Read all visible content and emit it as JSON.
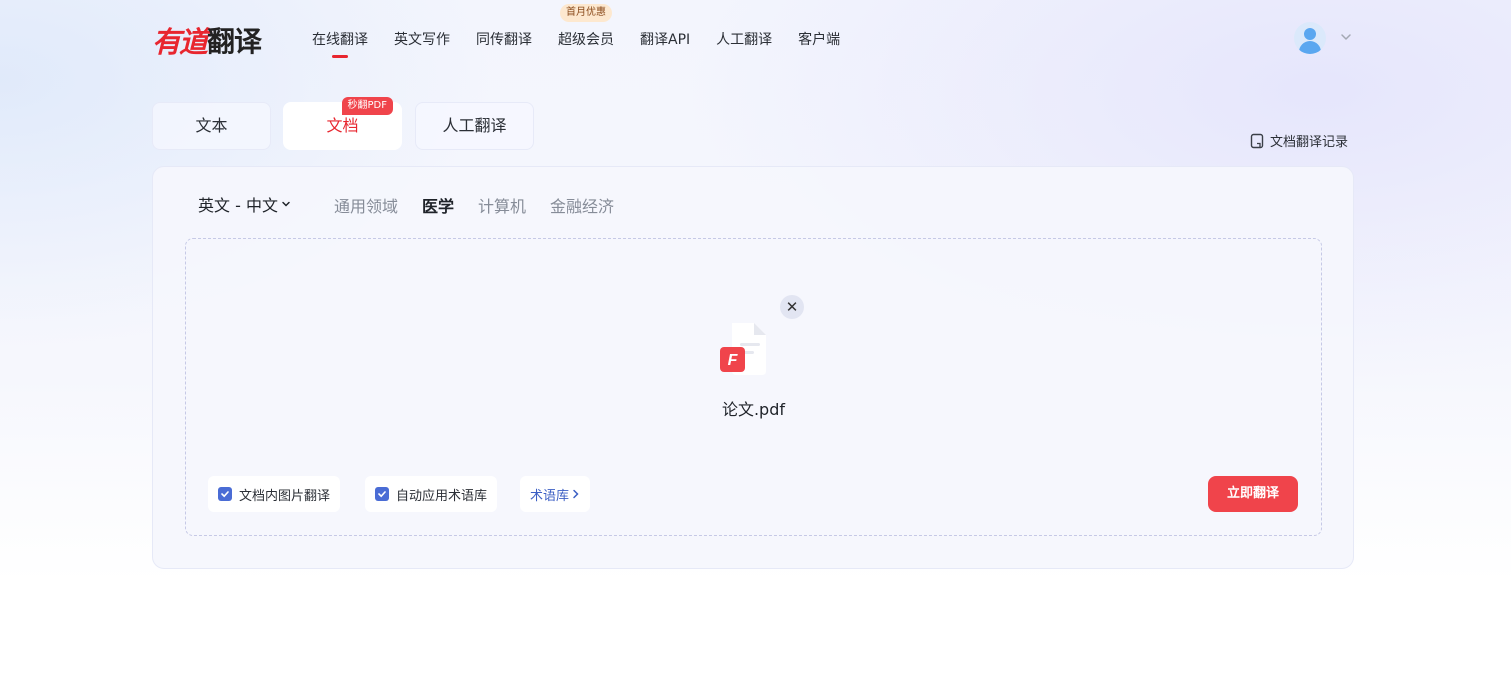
{
  "brand": {
    "logo_part1": "有道",
    "logo_part2": "翻译",
    "accent": "#e8262f"
  },
  "nav": {
    "items": [
      {
        "label": "在线翻译",
        "active": true
      },
      {
        "label": "英文写作"
      },
      {
        "label": "同传翻译"
      },
      {
        "label": "超级会员",
        "badge": "首月优惠"
      },
      {
        "label": "翻译API"
      },
      {
        "label": "人工翻译"
      },
      {
        "label": "客户端"
      }
    ]
  },
  "user": {
    "avatar_icon": "user-avatar-icon",
    "menu_icon": "chevron-down-icon"
  },
  "tabs": {
    "items": [
      {
        "label": "文本"
      },
      {
        "label": "文档",
        "active": true,
        "badge": "秒翻PDF"
      },
      {
        "label": "人工翻译"
      }
    ]
  },
  "history": {
    "label": "文档翻译记录",
    "icon": "document-history-icon"
  },
  "panel": {
    "language_pair": "英文 - 中文",
    "domains": [
      {
        "label": "通用领域"
      },
      {
        "label": "医学",
        "active": true
      },
      {
        "label": "计算机"
      },
      {
        "label": "金融经济"
      }
    ],
    "file": {
      "name": "论文.pdf",
      "icon": "pdf-file-icon",
      "icon_letter": "F",
      "remove_icon": "close-icon"
    },
    "options": [
      {
        "label": "文档内图片翻译",
        "checked": true
      },
      {
        "label": "自动应用术语库",
        "checked": true
      }
    ],
    "glossary_link": "术语库",
    "translate_button": "立即翻译"
  }
}
